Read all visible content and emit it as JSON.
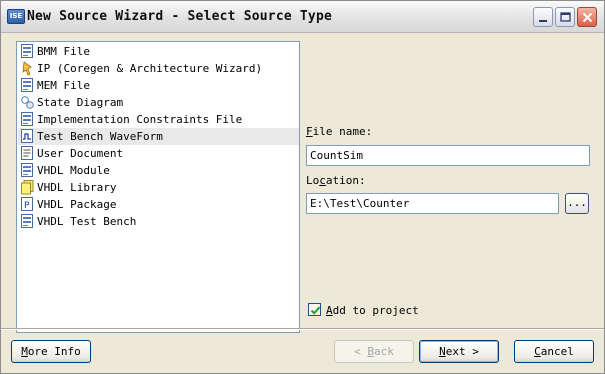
{
  "window": {
    "icon_text": "ISE",
    "title": "New Source Wizard - Select Source Type"
  },
  "source_types": [
    {
      "label": "BMM File",
      "icon": "bmm-file-icon",
      "icon_text": "BMM"
    },
    {
      "label": "IP (Coregen & Architecture Wizard)",
      "icon": "ip-wizard-icon",
      "icon_text": ""
    },
    {
      "label": "MEM File",
      "icon": "mem-file-icon",
      "icon_text": "MEM"
    },
    {
      "label": "State Diagram",
      "icon": "state-diagram-icon",
      "icon_text": ""
    },
    {
      "label": "Implementation Constraints File",
      "icon": "constraints-file-icon",
      "icon_text": "UCF"
    },
    {
      "label": "Test Bench WaveForm",
      "icon": "waveform-icon",
      "icon_text": "",
      "selected": true
    },
    {
      "label": "User Document",
      "icon": "document-icon",
      "icon_text": ""
    },
    {
      "label": "VHDL Module",
      "icon": "vhdl-module-icon",
      "icon_text": "VHD"
    },
    {
      "label": "VHDL Library",
      "icon": "vhdl-library-icon",
      "icon_text": ""
    },
    {
      "label": "VHDL Package",
      "icon": "vhdl-package-icon",
      "icon_text": "P"
    },
    {
      "label": "VHDL Test Bench",
      "icon": "vhdl-testbench-icon",
      "icon_text": "VHD"
    }
  ],
  "file_name": {
    "label_key": "F",
    "label_rest": "ile name:",
    "value": "CountSim"
  },
  "location": {
    "label_pre": "Lo",
    "label_key": "c",
    "label_rest": "ation:",
    "value": "E:\\Test\\Counter",
    "browse_label": "..."
  },
  "add_to_project": {
    "label_key": "A",
    "label_rest": "dd to project",
    "checked": true
  },
  "buttons": {
    "more_info": {
      "key": "M",
      "rest": "ore Info"
    },
    "back": {
      "pre": "< ",
      "key": "B",
      "rest": "ack"
    },
    "next": {
      "key": "N",
      "rest": "ext >"
    },
    "cancel": {
      "key": "C",
      "rest": "ancel"
    }
  },
  "colors": {
    "selection": "#e9e9e9",
    "field_border": "#7f9db9",
    "dialog_bg": "#ece9d8"
  }
}
